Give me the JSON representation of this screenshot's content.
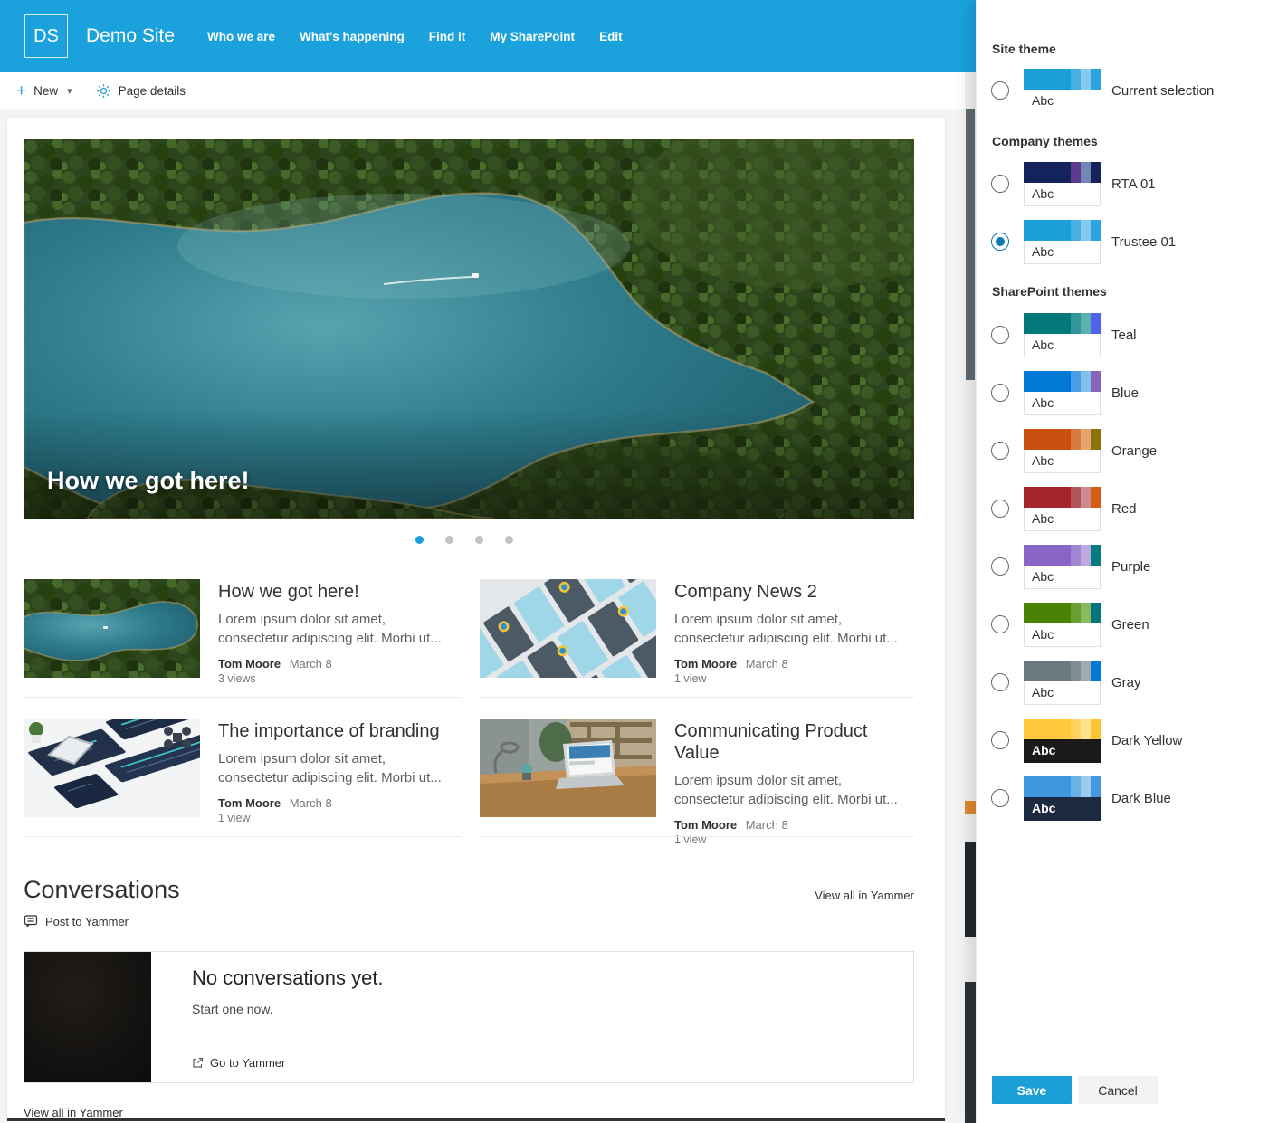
{
  "brand": {
    "suite_bar_color": "#1ba2dc",
    "accent": "#1b9fd9"
  },
  "suite_bar": {
    "logo": "DS",
    "site_title": "Demo Site",
    "nav": [
      "Who we are",
      "What's happening",
      "Find it",
      "My SharePoint",
      "Edit"
    ]
  },
  "toolbar": {
    "new_label": "New",
    "page_details_label": "Page details"
  },
  "hero": {
    "title": "How we got here!"
  },
  "news_cards": [
    {
      "title": "How we got here!",
      "body": "Lorem ipsum dolor sit amet, consectetur adipiscing elit. Morbi ut...",
      "author": "Tom Moore",
      "date": "March 8",
      "views": "3 views"
    },
    {
      "title": "Company News 2",
      "body": "Lorem ipsum dolor sit amet, consectetur adipiscing elit. Morbi ut...",
      "author": "Tom Moore",
      "date": "March 8",
      "views": "1 view"
    },
    {
      "title": "The importance of branding",
      "body": "Lorem ipsum dolor sit amet, consectetur adipiscing elit. Morbi ut...",
      "author": "Tom Moore",
      "date": "March 8",
      "views": "1 view"
    },
    {
      "title": "Communicating Product Value",
      "body": "Lorem ipsum dolor sit amet, consectetur adipiscing elit. Morbi ut...",
      "author": "Tom Moore",
      "date": "March 8",
      "views": "1 view"
    }
  ],
  "conversations": {
    "heading": "Conversations",
    "view_all": "View all in Yammer",
    "post_label": "Post to Yammer",
    "empty_title": "No conversations yet.",
    "empty_subtitle": "Start one now.",
    "goto_label": "Go to Yammer",
    "footer_link": "View all in Yammer"
  },
  "theme_panel": {
    "site_theme_heading": "Site theme",
    "company_heading": "Company themes",
    "sharepoint_heading": "SharePoint themes",
    "abc_label": "Abc",
    "save_label": "Save",
    "cancel_label": "Cancel",
    "items": [
      {
        "label": "Current selection",
        "colors": [
          "#1b9fd9",
          "#49b0e2",
          "#86cbee",
          "#2ba4dd"
        ],
        "abc_bg": "#ffffff",
        "abc_color": "#323130",
        "abc_weight": "400",
        "radio_ring": "#666666",
        "radio_dot": "transparent"
      },
      {
        "label": "RTA 01",
        "colors": [
          "#15235c",
          "#5c3b8e",
          "#7288b4",
          "#15235c"
        ],
        "abc_bg": "#ffffff",
        "abc_color": "#323130",
        "abc_weight": "400",
        "radio_ring": "#666666",
        "radio_dot": "transparent"
      },
      {
        "label": "Trustee 01",
        "colors": [
          "#1b9fd9",
          "#49b0e2",
          "#86cbee",
          "#2ba4dd"
        ],
        "abc_bg": "#ffffff",
        "abc_color": "#323130",
        "abc_weight": "400",
        "radio_ring": "#1077b0",
        "radio_dot": "#1077b0"
      },
      {
        "label": "Teal",
        "colors": [
          "#03787c",
          "#339599",
          "#5ab2ae",
          "#4f64ed"
        ],
        "abc_bg": "#ffffff",
        "abc_color": "#323130",
        "abc_weight": "400",
        "radio_ring": "#666666",
        "radio_dot": "transparent"
      },
      {
        "label": "Blue",
        "colors": [
          "#0078d4",
          "#4a9de2",
          "#84bfec",
          "#8764b8"
        ],
        "abc_bg": "#ffffff",
        "abc_color": "#323130",
        "abc_weight": "400",
        "radio_ring": "#666666",
        "radio_dot": "transparent"
      },
      {
        "label": "Orange",
        "colors": [
          "#ca5010",
          "#d87b42",
          "#e6a370",
          "#8d720a"
        ],
        "abc_bg": "#ffffff",
        "abc_color": "#323130",
        "abc_weight": "400",
        "radio_ring": "#666666",
        "radio_dot": "transparent"
      },
      {
        "label": "Red",
        "colors": [
          "#a4262c",
          "#b35459",
          "#cb8a90",
          "#d65c12"
        ],
        "abc_bg": "#ffffff",
        "abc_color": "#323130",
        "abc_weight": "400",
        "radio_ring": "#666666",
        "radio_dot": "transparent"
      },
      {
        "label": "Purple",
        "colors": [
          "#8965c5",
          "#a286d2",
          "#bcaade",
          "#067b80"
        ],
        "abc_bg": "#ffffff",
        "abc_color": "#323130",
        "abc_weight": "400",
        "radio_ring": "#666666",
        "radio_dot": "transparent"
      },
      {
        "label": "Green",
        "colors": [
          "#498205",
          "#699f31",
          "#8ab95e",
          "#03787c"
        ],
        "abc_bg": "#ffffff",
        "abc_color": "#323130",
        "abc_weight": "400",
        "radio_ring": "#666666",
        "radio_dot": "transparent"
      },
      {
        "label": "Gray",
        "colors": [
          "#69797e",
          "#808e93",
          "#9fabaf",
          "#0078d4"
        ],
        "abc_bg": "#ffffff",
        "abc_color": "#323130",
        "abc_weight": "400",
        "radio_ring": "#666666",
        "radio_dot": "transparent"
      },
      {
        "label": "Dark Yellow",
        "colors": [
          "#ffc83d",
          "#ffd35f",
          "#ffe28d",
          "#fdc430"
        ],
        "abc_bg": "#1b1a19",
        "abc_color": "#ffffff",
        "abc_weight": "700",
        "radio_ring": "#666666",
        "radio_dot": "transparent"
      },
      {
        "label": "Dark Blue",
        "colors": [
          "#3f97de",
          "#6cb0e6",
          "#9ccbf0",
          "#4499e0"
        ],
        "abc_bg": "#1b2a3f",
        "abc_color": "#ffffff",
        "abc_weight": "700",
        "radio_ring": "#666666",
        "radio_dot": "transparent"
      }
    ]
  }
}
